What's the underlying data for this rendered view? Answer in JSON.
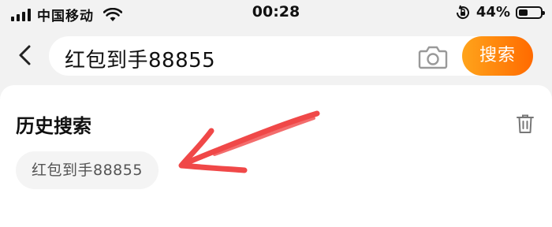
{
  "status_bar": {
    "carrier": "中国移动",
    "time": "00:28",
    "battery_percent": "44%",
    "battery_level": 0.44,
    "icons": [
      "signal-icon",
      "wifi-icon",
      "rotation-lock-icon",
      "battery-icon"
    ]
  },
  "search": {
    "query": "红包到手88855",
    "button_label": "搜索",
    "accent_gradient": [
      "#ffa41b",
      "#ff6a00"
    ],
    "icons": [
      "back-chevron-icon",
      "camera-icon"
    ]
  },
  "history": {
    "title": "历史搜索",
    "items": [
      "红包到手88855"
    ],
    "icons": [
      "trash-icon"
    ]
  },
  "annotation": {
    "type": "hand-drawn-arrow",
    "color": "#f04848"
  }
}
